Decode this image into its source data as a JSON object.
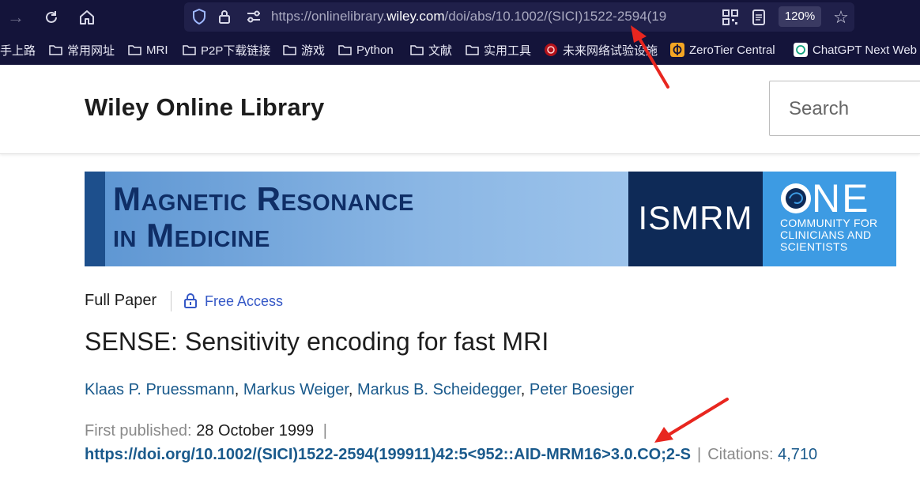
{
  "browser": {
    "url_prefix": "https://onlinelibrary.",
    "url_domain": "wiley.com",
    "url_suffix": "/doi/abs/10.1002/(SICI)1522-2594(19",
    "zoom": "120%"
  },
  "bookmarks": [
    {
      "label": "手上路",
      "icon": "folder-icon"
    },
    {
      "label": "常用网址",
      "icon": "folder-icon"
    },
    {
      "label": "MRI",
      "icon": "folder-icon"
    },
    {
      "label": "P2P下载链接",
      "icon": "folder-icon"
    },
    {
      "label": "游戏",
      "icon": "folder-icon"
    },
    {
      "label": "Python",
      "icon": "folder-icon"
    },
    {
      "label": "文献",
      "icon": "folder-icon"
    },
    {
      "label": "实用工具",
      "icon": "folder-icon"
    },
    {
      "label": "未来网络试验设施",
      "icon": "site-favicon"
    },
    {
      "label": "ZeroTier Central",
      "icon": "zerotier-icon"
    },
    {
      "label": "ChatGPT Next Web",
      "icon": "chatgpt-icon"
    }
  ],
  "site": {
    "logo": "Wiley Online Library",
    "search_placeholder": "Search"
  },
  "banner": {
    "title_line1": "Magnetic Resonance",
    "title_line2": "in Medicine",
    "ismrm": "ISMRM",
    "one": "NE",
    "one_sub": "COMMUNITY FOR CLINICIANS AND SCIENTISTS"
  },
  "article": {
    "type": "Full Paper",
    "access": "Free Access",
    "title": "SENSE: Sensitivity encoding for fast MRI",
    "authors": [
      "Klaas P. Pruessmann",
      "Markus Weiger",
      "Markus B. Scheidegger",
      "Peter Boesiger"
    ],
    "author_separator": ", ",
    "first_published_label": "First published:",
    "first_published_date": "28 October 1999",
    "separator": "|",
    "doi": "https://doi.org/10.1002/(SICI)1522-2594(199911)42:5<952::AID-MRM16>3.0.CO;2-S",
    "citations_label": "Citations:",
    "citations_count": "4,710"
  },
  "colors": {
    "browser_bg": "#14143a",
    "link": "#1a5a8c",
    "free_access": "#3558c6",
    "annotation": "#e8261f"
  }
}
